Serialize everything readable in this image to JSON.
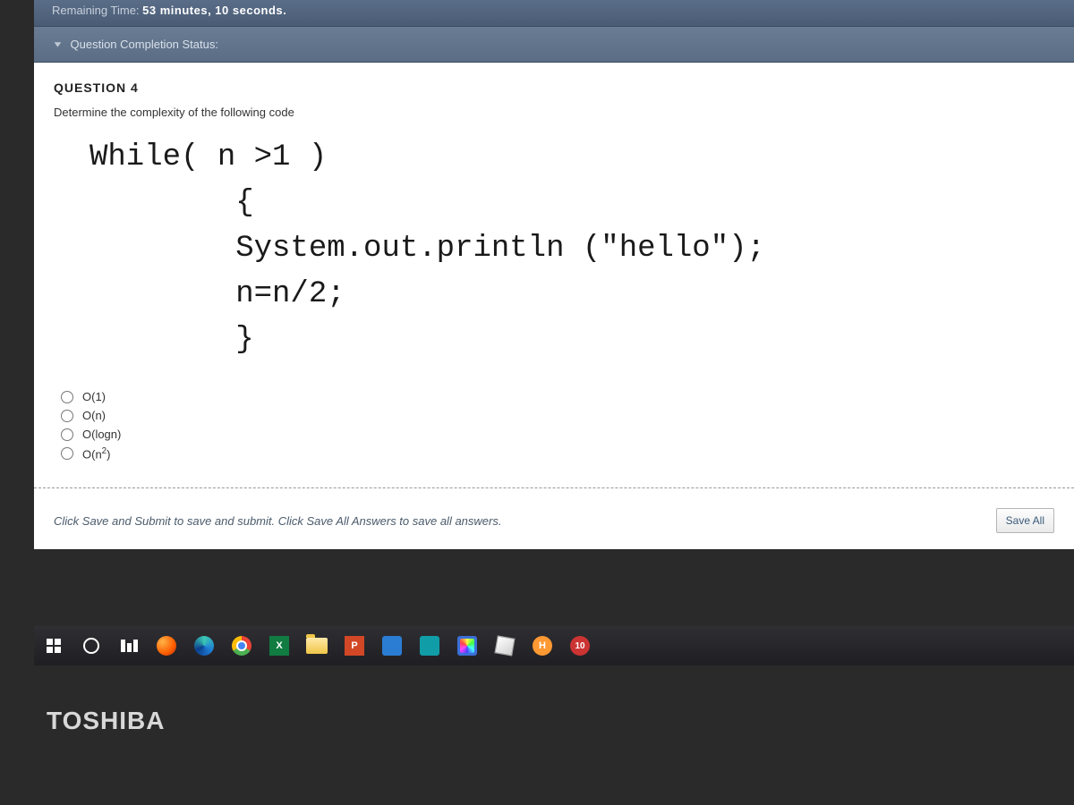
{
  "timer": {
    "label": "Remaining Time:",
    "value": "53 minutes, 10 seconds."
  },
  "statusBar": {
    "label": "Question Completion Status:"
  },
  "question": {
    "header": "QUESTION 4",
    "prompt": "Determine the complexity of the following code",
    "code": "While( n >1 )\n        {\n        System.out.println (\"hello\");\n        n=n/2;\n        }",
    "options": [
      {
        "label_html": "O(1)"
      },
      {
        "label_html": "O(n)"
      },
      {
        "label_html": "O(logn)"
      },
      {
        "label_html": "O(n<sup>2</sup>)"
      }
    ]
  },
  "footer": {
    "instructions": "Click Save and Submit to save and submit. Click Save All Answers to save all answers.",
    "save_all_label": "Save All"
  },
  "taskbar": {
    "excel_letter": "X",
    "ppt_letter": "P",
    "hot_letter": "H",
    "badge_number": "10"
  },
  "brand": "TOSHIBA"
}
